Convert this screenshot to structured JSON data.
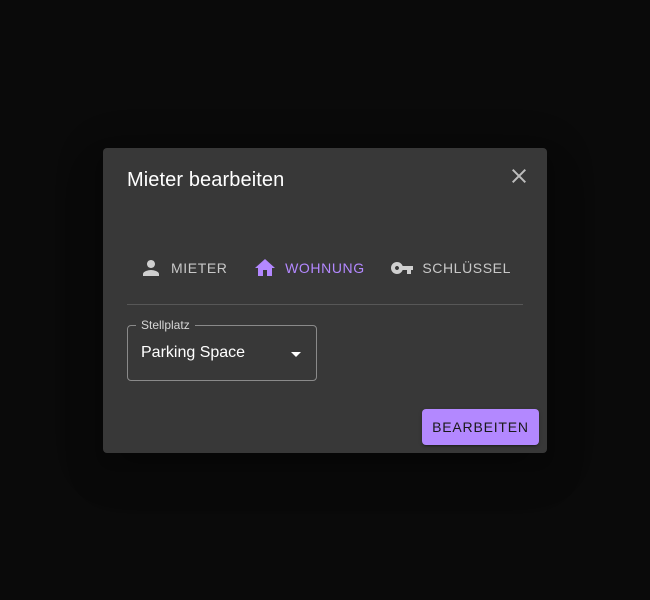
{
  "dialog": {
    "title": "Mieter bearbeiten",
    "close_icon": "close-icon"
  },
  "tabs": [
    {
      "label": "MIETER",
      "icon": "person-icon",
      "active": false
    },
    {
      "label": "WOHNUNG",
      "icon": "home-icon",
      "active": true
    },
    {
      "label": "SCHLÜSSEL",
      "icon": "key-icon",
      "active": false
    }
  ],
  "form": {
    "parking": {
      "label": "Stellplatz",
      "value": "Parking Space"
    }
  },
  "actions": {
    "submit_label": "BEARBEITEN"
  },
  "colors": {
    "accent": "#b388ff",
    "dialog_bg": "#383838",
    "backdrop": "#0a0a0a",
    "text_primary": "#ffffff",
    "text_secondary": "#c8c8c8"
  }
}
